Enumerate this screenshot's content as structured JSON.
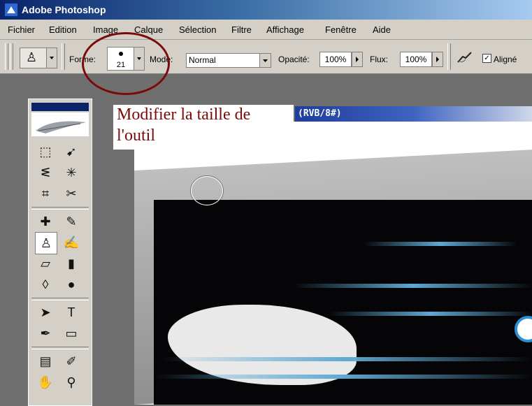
{
  "window": {
    "title": "Adobe Photoshop"
  },
  "menubar": {
    "items": [
      "Fichier",
      "Edition",
      "Image",
      "Calque",
      "Sélection",
      "Filtre",
      "Affichage",
      "Fenêtre",
      "Aide"
    ]
  },
  "options": {
    "forme_label": "Forme:",
    "brush_size": "21",
    "mode_label": "Mode:",
    "mode_value": "Normal",
    "opacite_label": "Opacité:",
    "opacite_value": "100%",
    "flux_label": "Flux:",
    "flux_value": "100%",
    "aligne_label": "Aligné",
    "aligne_checked": "✓"
  },
  "document": {
    "title": "(RVB/8#)"
  },
  "annotation": {
    "line1": "Modifier la taille de",
    "line2": "l'outil"
  },
  "colors": {
    "title_gradient_start": "#0a246a",
    "annotation_red": "#7b0b0b",
    "chrome": "#d4d0c8"
  },
  "toolbox": {
    "tools": [
      "marquee-icon",
      "move-icon",
      "lasso-icon",
      "magic-wand-icon",
      "crop-icon",
      "slice-icon",
      "healing-brush-icon",
      "brush-icon",
      "clone-stamp-icon",
      "history-brush-icon",
      "eraser-icon",
      "gradient-icon",
      "blur-icon",
      "dodge-icon",
      "path-selection-icon",
      "type-icon",
      "pen-icon",
      "shape-icon",
      "notes-icon",
      "eyedropper-icon",
      "hand-icon",
      "zoom-icon"
    ]
  }
}
